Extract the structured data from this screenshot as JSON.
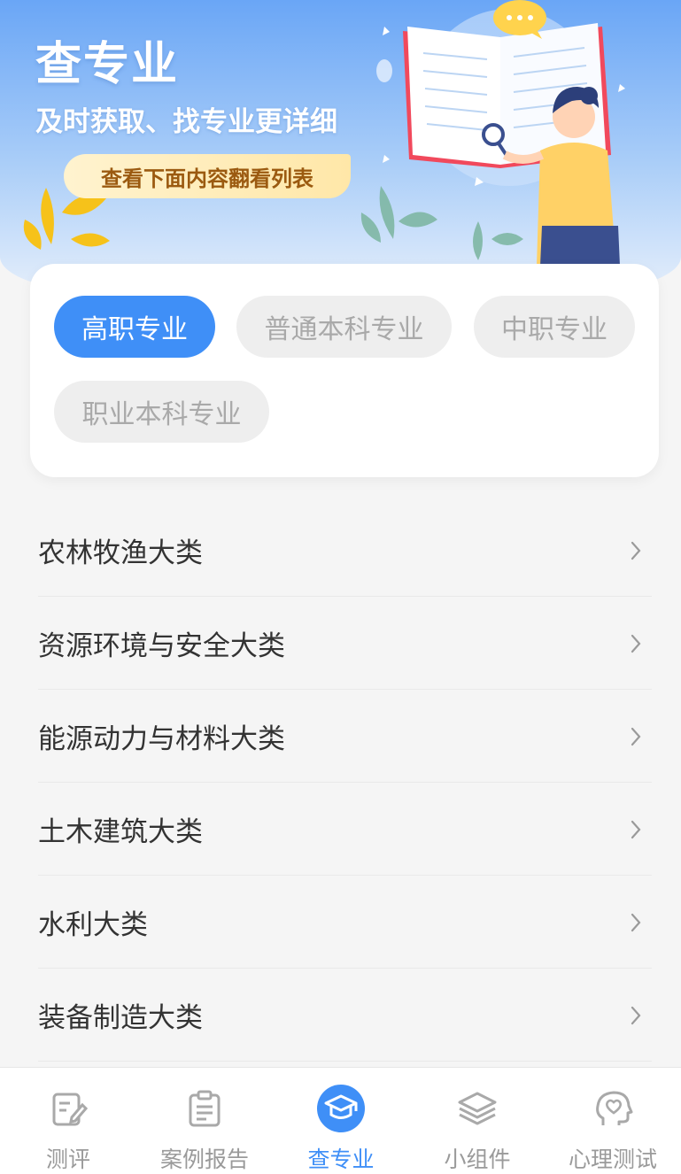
{
  "header": {
    "title": "查专业",
    "subtitle": "及时获取、找专业更详细",
    "hint": "查看下面内容翻看列表"
  },
  "filters": [
    {
      "label": "高职专业",
      "active": true
    },
    {
      "label": "普通本科专业",
      "active": false
    },
    {
      "label": "中职专业",
      "active": false
    },
    {
      "label": "职业本科专业",
      "active": false
    }
  ],
  "categories": [
    {
      "label": "农林牧渔大类"
    },
    {
      "label": "资源环境与安全大类"
    },
    {
      "label": "能源动力与材料大类"
    },
    {
      "label": "土木建筑大类"
    },
    {
      "label": "水利大类"
    },
    {
      "label": "装备制造大类"
    }
  ],
  "tabbar": [
    {
      "label": "测评",
      "icon": "edit-note-icon",
      "active": false
    },
    {
      "label": "案例报告",
      "icon": "clipboard-icon",
      "active": false
    },
    {
      "label": "查专业",
      "icon": "graduation-cap-icon",
      "active": true
    },
    {
      "label": "小组件",
      "icon": "layers-icon",
      "active": false
    },
    {
      "label": "心理测试",
      "icon": "head-heart-icon",
      "active": false
    }
  ],
  "colors": {
    "accent": "#3f8ff7",
    "hero_top": "#6aa6f6",
    "hint_text": "#9b5a10",
    "inactive": "#9a9a9a"
  }
}
